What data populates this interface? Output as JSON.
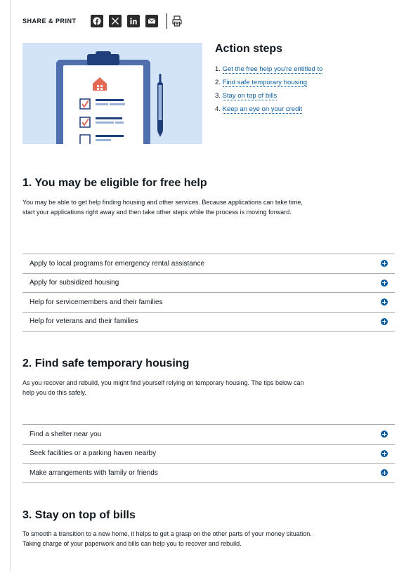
{
  "share": {
    "label": "SHARE & PRINT",
    "icons": [
      "facebook-icon",
      "x-twitter-icon",
      "linkedin-icon",
      "email-icon",
      "print-icon"
    ]
  },
  "action_steps": {
    "title": "Action steps",
    "items": [
      {
        "num": "1.",
        "label": "Get the free help you're entitled to"
      },
      {
        "num": "2.",
        "label": "Find safe temporary housing"
      },
      {
        "num": "3.",
        "label": "Stay on top of bills"
      },
      {
        "num": "4.",
        "label": "Keep an eye on your credit"
      }
    ]
  },
  "sections": [
    {
      "title": "1. You may be eligible for free help",
      "body": "You may be able to get help finding housing and other services. Because applications can take time, start your applications right away and then take other steps while the process is moving forward.",
      "accordion": [
        "Apply to local programs for emergency rental assistance",
        "Apply for subsidized housing",
        "Help for servicemembers and their families",
        "Help for veterans and their families"
      ]
    },
    {
      "title": "2. Find safe temporary housing",
      "body": "As you recover and rebuild, you might find yourself relying on temporary housing. The tips below can help you do this safely.",
      "accordion": [
        "Find a shelter near you",
        "Seek facilities or a parking haven nearby",
        "Make arrangements with family or friends"
      ]
    },
    {
      "title": "3. Stay on top of bills",
      "body": "To smooth a transition to a new home, it helps to get a grasp on the other parts of your money situation. Taking charge of your paperwork and bills can help you to recover and rebuild."
    }
  ],
  "colors": {
    "link": "#0a5c9e",
    "accent_red": "#d9534f",
    "hero_bg": "#d4e4f8",
    "navy": "#1f3f7a"
  }
}
